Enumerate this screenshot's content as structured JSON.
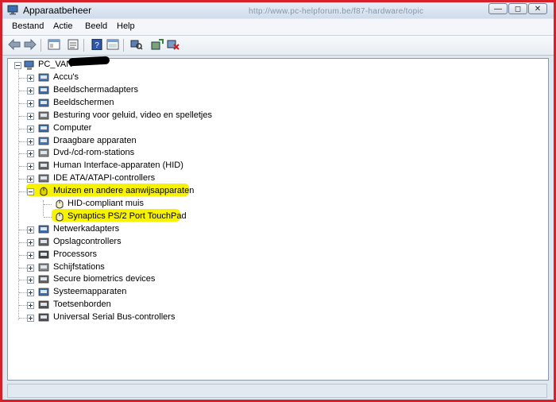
{
  "window": {
    "title": "Apparaatbeheer",
    "bg_url_text": "http://www.pc-helpforum.be/f87-hardware/topic"
  },
  "menu": [
    {
      "label": "Bestand"
    },
    {
      "label": "Actie"
    },
    {
      "label": "Beeld"
    },
    {
      "label": "Help"
    }
  ],
  "tree": {
    "root": "PC_VAN",
    "categories": [
      {
        "label": "Accu's",
        "icon": "battery-icon"
      },
      {
        "label": "Beeldschermadapters",
        "icon": "display-adapter-icon"
      },
      {
        "label": "Beeldschermen",
        "icon": "monitor-icon"
      },
      {
        "label": "Besturing voor geluid, video en spelletjes",
        "icon": "speaker-icon"
      },
      {
        "label": "Computer",
        "icon": "computer-icon"
      },
      {
        "label": "Draagbare apparaten",
        "icon": "portable-device-icon"
      },
      {
        "label": "Dvd-/cd-rom-stations",
        "icon": "dvd-icon"
      },
      {
        "label": "Human Interface-apparaten (HID)",
        "icon": "hid-icon"
      },
      {
        "label": "IDE ATA/ATAPI-controllers",
        "icon": "ide-icon"
      },
      {
        "label": "Muizen en andere aanwijsapparaten",
        "icon": "mouse-icon",
        "expanded": true,
        "children": [
          {
            "label": "HID-compliant muis"
          },
          {
            "label": "Synaptics PS/2 Port TouchPad"
          }
        ]
      },
      {
        "label": "Netwerkadapters",
        "icon": "network-icon"
      },
      {
        "label": "Opslagcontrollers",
        "icon": "storage-icon"
      },
      {
        "label": "Processors",
        "icon": "cpu-icon"
      },
      {
        "label": "Schijfstations",
        "icon": "disk-icon"
      },
      {
        "label": "Secure biometrics devices",
        "icon": "biometric-icon"
      },
      {
        "label": "Systeemapparaten",
        "icon": "system-icon"
      },
      {
        "label": "Toetsenborden",
        "icon": "keyboard-icon"
      },
      {
        "label": "Universal Serial Bus-controllers",
        "icon": "usb-icon"
      }
    ]
  },
  "colors": {
    "highlight": "#f7f200",
    "frame": "#d8202a"
  }
}
